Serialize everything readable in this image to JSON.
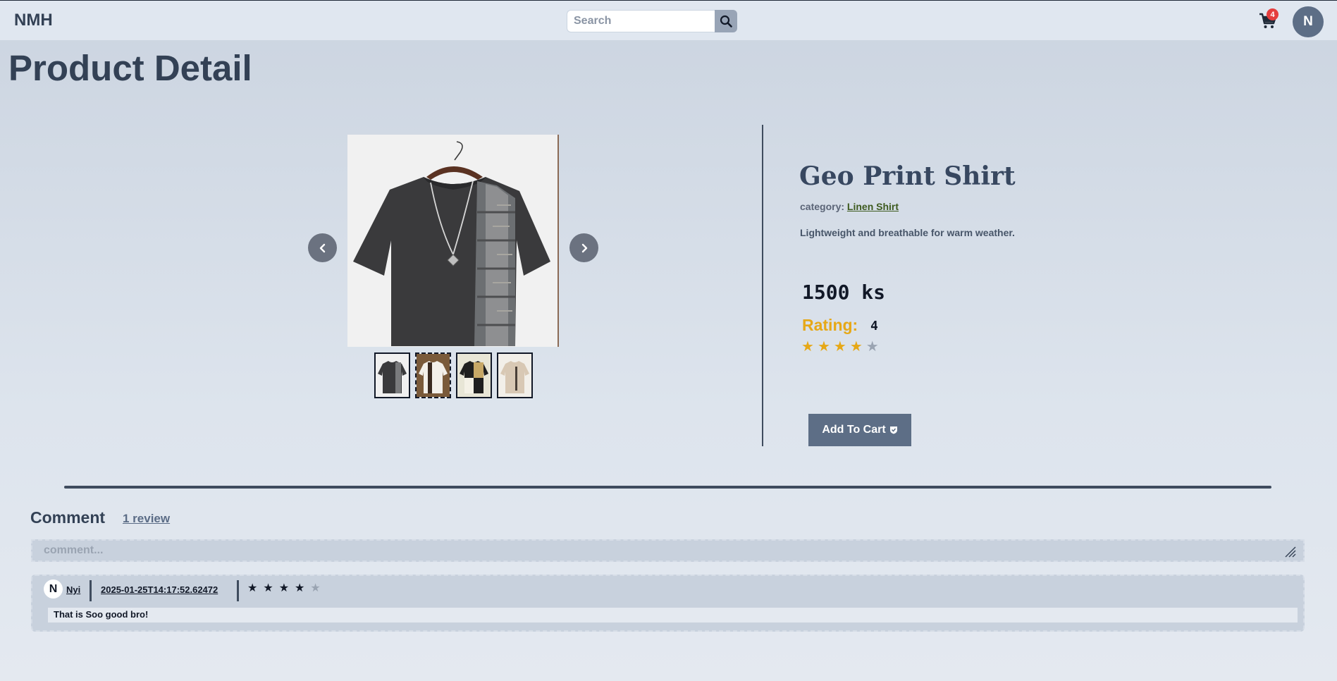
{
  "header": {
    "brand": "NMH",
    "search_placeholder": "Search",
    "cart_count": "4",
    "user_initial": "N"
  },
  "page_title": "Product Detail",
  "product": {
    "name": "Geo Print Shirt",
    "category_label": "category:",
    "category": "Linen Shirt",
    "description": "Lightweight and breathable for warm weather.",
    "price": "1500 ks",
    "rating_label": "Rating:",
    "rating_value": "4",
    "rating_stars": 4,
    "rating_max": 5,
    "add_to_cart_label": "Add To Cart"
  },
  "comments": {
    "title": "Comment",
    "review_count": "1 review",
    "input_placeholder": "comment...",
    "reviews": [
      {
        "avatar_initial": "N",
        "user": "Nyi",
        "date": "2025-01-25T14:17:52.62472",
        "stars": 4,
        "text": "That is Soo good bro!"
      }
    ]
  },
  "colors": {
    "accent": "#5d6e86",
    "star": "#e6a817",
    "badge": "#e53e3e"
  }
}
